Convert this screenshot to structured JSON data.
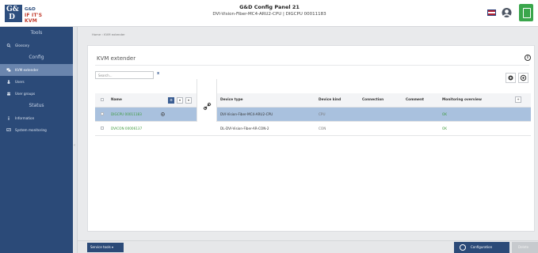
{
  "app": {
    "logo_badge": "G&\nD",
    "logo_line1": "G&D",
    "logo_line2": "IF IT'S KVM",
    "title": "G&D Config Panel 21",
    "subtitle": "DVI-Vision-Fiber-MC4-ARU2-CPU | DIGCPU 00011183"
  },
  "sidebar": {
    "sections": [
      {
        "label": "Tools",
        "items": [
          {
            "label": "Glossary",
            "icon": "search-icon"
          }
        ]
      },
      {
        "label": "Config",
        "items": [
          {
            "label": "KVM extender",
            "icon": "kvm-icon",
            "active": true
          },
          {
            "label": "Users",
            "icon": "user-icon"
          },
          {
            "label": "User groups",
            "icon": "users-icon"
          }
        ]
      },
      {
        "label": "Status",
        "items": [
          {
            "label": "Information",
            "icon": "info-icon"
          },
          {
            "label": "System monitoring",
            "icon": "monitor-icon"
          }
        ]
      }
    ]
  },
  "breadcrumb": "Home › KVM extender",
  "panel": {
    "title": "KVM extender",
    "search_placeholder": "Search...",
    "search_clear": "x",
    "info_glyph": "i"
  },
  "table": {
    "columns": [
      "Name",
      "Device type",
      "Device kind",
      "Connection",
      "Comment",
      "Monitoring overview"
    ],
    "rows": [
      {
        "name": "DIGCPU 00011183",
        "device_type": "DVI-Vision-Fiber-MC4-ARU2-CPU",
        "device_kind": "CPU",
        "connection": "",
        "comment": "",
        "monitoring": "OK",
        "selected": true
      },
      {
        "name": "DVICON 00006137",
        "device_type": "DL-DVI-Vision-Fiber-AR-CON-2",
        "device_kind": "CON",
        "connection": "",
        "comment": "",
        "monitoring": "OK",
        "selected": false
      }
    ]
  },
  "bottombar": {
    "service_tools": "Service tools",
    "service_arrow": "▾",
    "configuration": "Configuration",
    "delete": "Delete"
  },
  "colors": {
    "sidebar": "#2b4a78",
    "accent": "#3b5e93",
    "selected_row": "#a9c1de",
    "status_ok": "#3f9a3f",
    "brand_red": "#c0392b",
    "monitor_green": "#3aa64c"
  }
}
